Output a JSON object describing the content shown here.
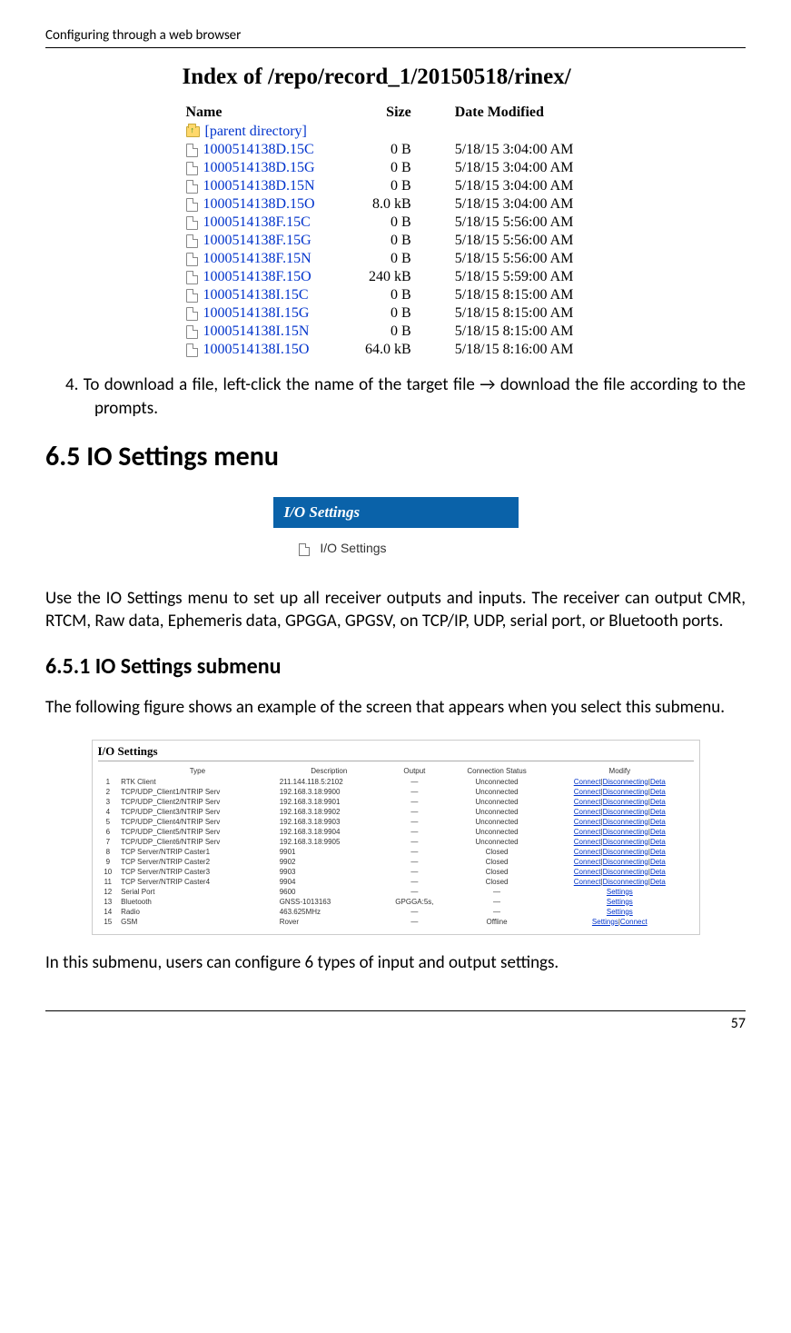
{
  "header": {
    "section_title": "Configuring through a web browser"
  },
  "fig1": {
    "heading": "Index of /repo/record_1/20150518/rinex/",
    "columns": {
      "name": "Name",
      "size": "Size",
      "date": "Date Modified"
    },
    "parent_label": "[parent directory]",
    "rows": [
      {
        "name": "1000514138D.15C",
        "size": "0 B",
        "date": "5/18/15 3:04:00 AM"
      },
      {
        "name": "1000514138D.15G",
        "size": "0 B",
        "date": "5/18/15 3:04:00 AM"
      },
      {
        "name": "1000514138D.15N",
        "size": "0 B",
        "date": "5/18/15 3:04:00 AM"
      },
      {
        "name": "1000514138D.15O",
        "size": "8.0 kB",
        "date": "5/18/15 3:04:00 AM"
      },
      {
        "name": "1000514138F.15C",
        "size": "0 B",
        "date": "5/18/15 5:56:00 AM"
      },
      {
        "name": "1000514138F.15G",
        "size": "0 B",
        "date": "5/18/15 5:56:00 AM"
      },
      {
        "name": "1000514138F.15N",
        "size": "0 B",
        "date": "5/18/15 5:56:00 AM"
      },
      {
        "name": "1000514138F.15O",
        "size": "240 kB",
        "date": "5/18/15 5:59:00 AM"
      },
      {
        "name": "1000514138I.15C",
        "size": "0 B",
        "date": "5/18/15 8:15:00 AM"
      },
      {
        "name": "1000514138I.15G",
        "size": "0 B",
        "date": "5/18/15 8:15:00 AM"
      },
      {
        "name": "1000514138I.15N",
        "size": "0 B",
        "date": "5/18/15 8:15:00 AM"
      },
      {
        "name": "1000514138I.15O",
        "size": "64.0 kB",
        "date": "5/18/15 8:16:00 AM"
      }
    ]
  },
  "list_item_4": "4.   To download a file, left-click the name of the target file → download the file according to the prompts.",
  "h2": "6.5  IO Settings menu",
  "fig2": {
    "header": "I/O Settings",
    "item": "I/O Settings"
  },
  "para_intro": "Use the IO Settings menu to set up all receiver outputs and inputs. The receiver can output CMR, RTCM, Raw data, Ephemeris data, GPGGA, GPGSV, on TCP/IP, UDP, serial port, or Bluetooth ports.",
  "h3": "6.5.1  IO Settings submenu",
  "para_sub": "The following figure shows an example of the screen that appears when you select this submenu.",
  "fig3": {
    "title": "I/O Settings",
    "columns": {
      "num": "",
      "type": "Type",
      "desc": "Description",
      "output": "Output",
      "status": "Connection Status",
      "modify": "Modify"
    },
    "links": {
      "connect": "Connect",
      "disconnecting": "Disconnecting",
      "deta": "Deta",
      "settings": "Settings"
    },
    "rows": [
      {
        "n": "1",
        "type": "RTK Client",
        "desc": "211.144.118.5:2102",
        "out": "—",
        "status": "Unconnected",
        "modify": "cdd"
      },
      {
        "n": "2",
        "type": "TCP/UDP_Client1/NTRIP Serv",
        "desc": "192.168.3.18:9900",
        "out": "—",
        "status": "Unconnected",
        "modify": "cdd"
      },
      {
        "n": "3",
        "type": "TCP/UDP_Client2/NTRIP Serv",
        "desc": "192.168.3.18:9901",
        "out": "—",
        "status": "Unconnected",
        "modify": "cdd"
      },
      {
        "n": "4",
        "type": "TCP/UDP_Client3/NTRIP Serv",
        "desc": "192.168.3.18:9902",
        "out": "—",
        "status": "Unconnected",
        "modify": "cdd"
      },
      {
        "n": "5",
        "type": "TCP/UDP_Client4/NTRIP Serv",
        "desc": "192.168.3.18:9903",
        "out": "—",
        "status": "Unconnected",
        "modify": "cdd"
      },
      {
        "n": "6",
        "type": "TCP/UDP_Client5/NTRIP Serv",
        "desc": "192.168.3.18:9904",
        "out": "—",
        "status": "Unconnected",
        "modify": "cdd"
      },
      {
        "n": "7",
        "type": "TCP/UDP_Client6/NTRIP Serv",
        "desc": "192.168.3.18:9905",
        "out": "—",
        "status": "Unconnected",
        "modify": "cdd"
      },
      {
        "n": "8",
        "type": "TCP Server/NTRIP Caster1",
        "desc": "9901",
        "out": "—",
        "status": "Closed",
        "modify": "cdd"
      },
      {
        "n": "9",
        "type": "TCP Server/NTRIP Caster2",
        "desc": "9902",
        "out": "—",
        "status": "Closed",
        "modify": "cdd"
      },
      {
        "n": "10",
        "type": "TCP Server/NTRIP Caster3",
        "desc": "9903",
        "out": "—",
        "status": "Closed",
        "modify": "cdd"
      },
      {
        "n": "11",
        "type": "TCP Server/NTRIP Caster4",
        "desc": "9904",
        "out": "—",
        "status": "Closed",
        "modify": "cdd"
      },
      {
        "n": "12",
        "type": "Serial Port",
        "desc": "9600",
        "out": "—",
        "status": "—",
        "modify": "s"
      },
      {
        "n": "13",
        "type": "Bluetooth",
        "desc": "GNSS-1013163",
        "out": "GPGGA:5s,",
        "status": "—",
        "modify": "s"
      },
      {
        "n": "14",
        "type": "Radio",
        "desc": "463.625MHz",
        "out": "—",
        "status": "—",
        "modify": "s"
      },
      {
        "n": "15",
        "type": "GSM",
        "desc": "Rover",
        "out": "—",
        "status": "Offline",
        "modify": "sc"
      }
    ]
  },
  "para_last": "In this submenu, users can configure 6 types of input and output settings.",
  "page_number": "57"
}
